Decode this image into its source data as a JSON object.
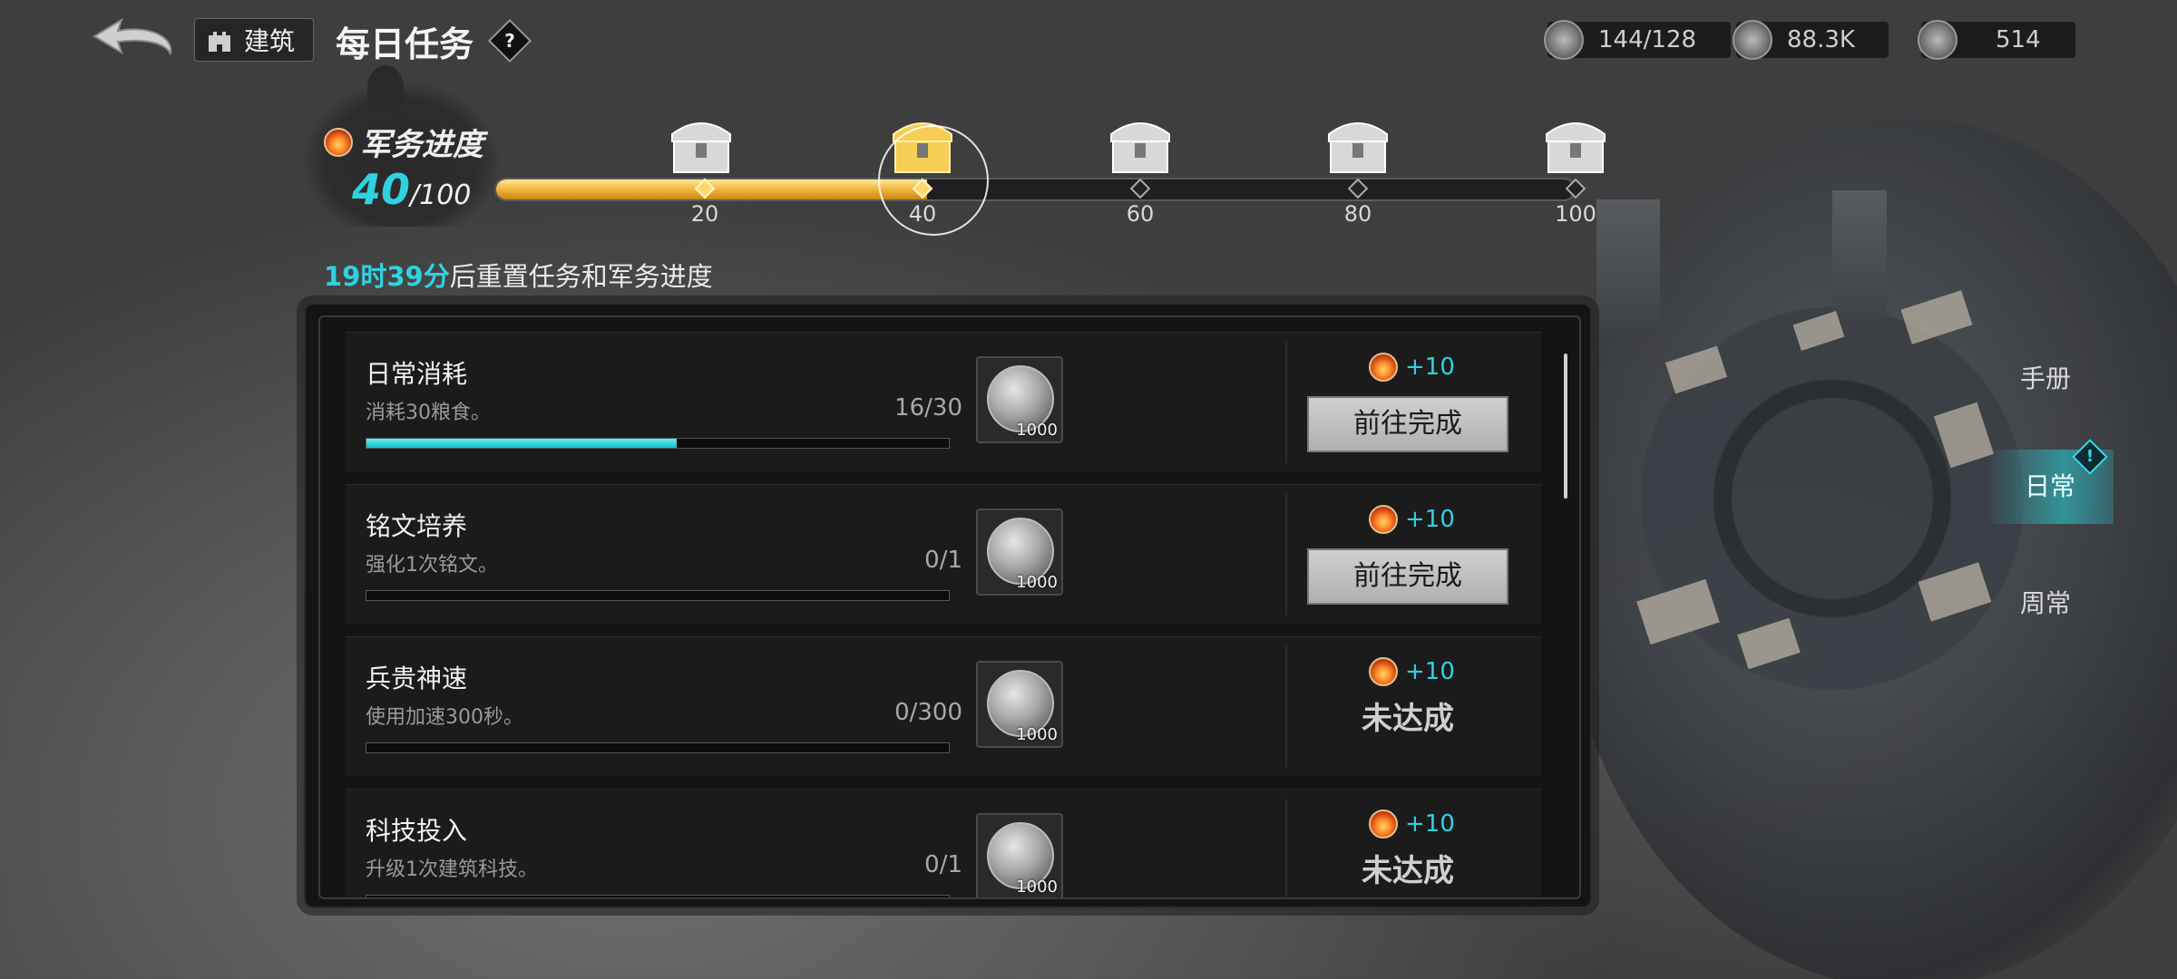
{
  "header": {
    "build_label": "建筑",
    "title": "每日任务",
    "help_glyph": "?"
  },
  "resources": [
    {
      "name": "grain",
      "icon": "wheat-icon",
      "value": "144/128"
    },
    {
      "name": "troops",
      "icon": "tower-icon",
      "value": "88.3K"
    },
    {
      "name": "shield",
      "icon": "shield-icon",
      "value": "514"
    }
  ],
  "mission": {
    "label": "军务进度",
    "current": "40",
    "max": "/100",
    "progress_fraction": 0.4,
    "milestones": [
      "20",
      "40",
      "60",
      "80",
      "100"
    ],
    "reached_milestone_index": 1,
    "reset_time": "19时39分",
    "reset_text": "后重置任务和军务进度"
  },
  "tasks": [
    {
      "name": "日常消耗",
      "desc": "消耗30粮食。",
      "count": "16/30",
      "progress": 0.533,
      "reward_qty": "1000",
      "points": "+10",
      "action": "前往完成",
      "state": "go"
    },
    {
      "name": "铭文培养",
      "desc": "强化1次铭文。",
      "count": "0/1",
      "progress": 0,
      "reward_qty": "1000",
      "points": "+10",
      "action": "前往完成",
      "state": "go"
    },
    {
      "name": "兵贵神速",
      "desc": "使用加速300秒。",
      "count": "0/300",
      "progress": 0,
      "reward_qty": "1000",
      "points": "+10",
      "action": "未达成",
      "state": "undone"
    },
    {
      "name": "科技投入",
      "desc": "升级1次建筑科技。",
      "count": "0/1",
      "progress": 0,
      "reward_qty": "1000",
      "points": "+10",
      "action": "未达成",
      "state": "undone"
    }
  ],
  "side_tabs": [
    {
      "label": "手册",
      "active": false
    },
    {
      "label": "日常",
      "active": true
    },
    {
      "label": "周常",
      "active": false
    }
  ],
  "colors": {
    "accent": "#2fd2df",
    "progress_gold": "#f2b53a",
    "task_bar": "#1bb9c5"
  }
}
